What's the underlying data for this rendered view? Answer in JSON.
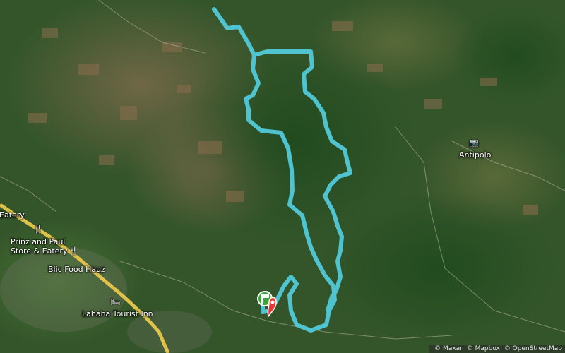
{
  "map": {
    "basemap": "satellite",
    "route_color": "#4fc3cf",
    "start_marker_color": "#3aa63a",
    "end_marker_color": "#e53935",
    "places": [
      {
        "key": "eatery",
        "label": "Eatery",
        "icon": "fork-knife-icon"
      },
      {
        "key": "prinz",
        "label": "Prinz and Paul\nStore & Eatery",
        "icon": "fork-knife-icon"
      },
      {
        "key": "blic",
        "label": "Blic Food Hauz",
        "icon": "fork-knife-icon"
      },
      {
        "key": "lahaha",
        "label": "Lahaha Tourist Inn",
        "icon": "bed-icon"
      },
      {
        "key": "antipolo",
        "label": "Antipolo",
        "icon": "camera-icon"
      }
    ],
    "attribution": [
      "© Maxar",
      "© Mapbox",
      "© OpenStreetMap"
    ]
  }
}
